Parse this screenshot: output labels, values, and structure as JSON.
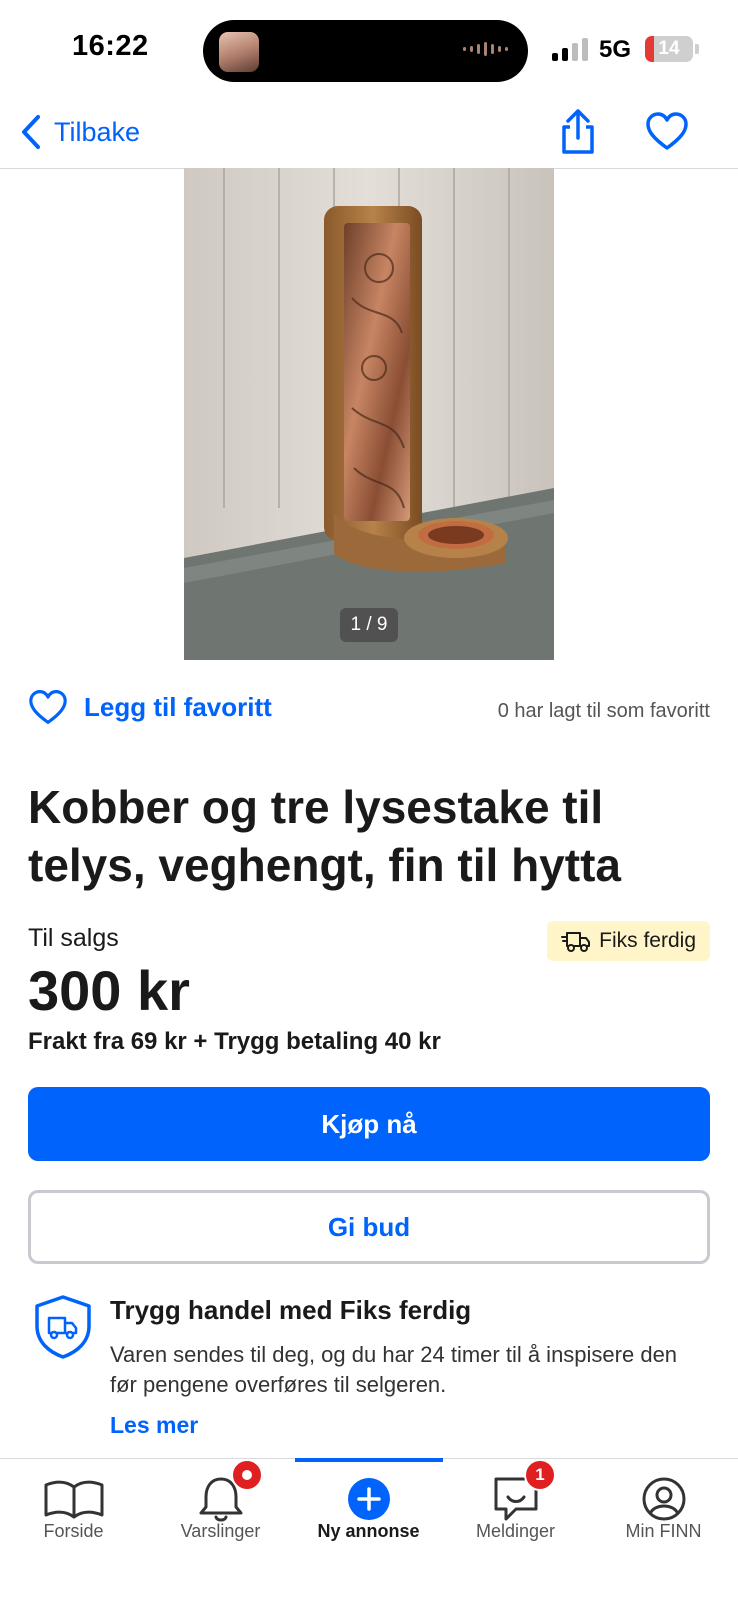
{
  "status_bar": {
    "time": "16:22",
    "network": "5G",
    "battery_percent": "14"
  },
  "nav": {
    "back_label": "Tilbake"
  },
  "gallery": {
    "counter": "1 / 9"
  },
  "favorite": {
    "label": "Legg til favoritt",
    "count_text": "0 har lagt til som favoritt"
  },
  "listing": {
    "title": "Kobber og tre lysestake til telys, veghengt, fin til hytta",
    "status": "Til salgs",
    "price": "300 kr",
    "shipping": "Frakt fra 69 kr + Trygg betaling 40 kr",
    "shipping_badge": "Fiks ferdig"
  },
  "actions": {
    "buy_label": "Kjøp nå",
    "bid_label": "Gi bud"
  },
  "trygg": {
    "title": "Trygg handel med Fiks ferdig",
    "text": "Varen sendes til deg, og du har 24 timer til å inspisere den før pengene overføres til selgeren.",
    "link": "Les mer"
  },
  "tabbar": {
    "tabs": [
      {
        "label": "Forside",
        "icon": "book-icon"
      },
      {
        "label": "Varslinger",
        "icon": "bell-icon"
      },
      {
        "label": "Ny annonse",
        "icon": "plus-icon"
      },
      {
        "label": "Meldinger",
        "icon": "message-icon"
      },
      {
        "label": "Min FINN",
        "icon": "profile-icon"
      }
    ],
    "active_index": 2,
    "messages_badge": "1"
  },
  "colors": {
    "accent": "#0063fb",
    "badge_red": "#e02020",
    "badge_yellow": "#fff5c8"
  }
}
